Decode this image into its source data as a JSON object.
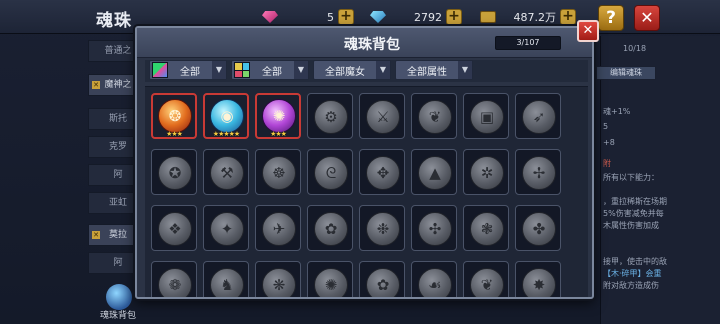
{
  "topbar": {
    "title": "魂珠",
    "resources": [
      {
        "icon": "pink-gem-icon",
        "value": "5"
      },
      {
        "icon": "blue-gem-icon",
        "value": "2792"
      },
      {
        "icon": "treasure-chest-icon",
        "value": "487.2万"
      }
    ],
    "help_label": "?",
    "close_label": "✕"
  },
  "sidebar": {
    "items": [
      "普通之",
      "魔神之",
      "斯托",
      "克罗",
      "阿",
      "亚虹",
      "",
      "莫拉",
      "阿"
    ],
    "bottom_label": "魂珠背包"
  },
  "right_panel": {
    "progress": "10/18",
    "button": "编辑魂珠",
    "lines": [
      "魂+1%",
      "5",
      "+8",
      "附",
      "所有以下能力：",
      "，重拉稀斯在场期",
      "5%伤害减免并每",
      "木属性伤害加成",
      "接甲，使击中的敌",
      "【木·碎甲】会重",
      "附对敌方造成伤"
    ]
  },
  "modal": {
    "title": "魂珠背包",
    "count": "3/107",
    "close_label": "✕",
    "filters": [
      {
        "icon": "rainbow-icon",
        "label": "全部",
        "arrow": "▼"
      },
      {
        "icon": "element-grid-icon",
        "label": "全部",
        "arrow": "▼"
      },
      {
        "label": "全部魔女",
        "arrow": "▼"
      },
      {
        "label": "全部属性",
        "arrow": "▼"
      }
    ],
    "slots": [
      {
        "kind": "fire",
        "glyph": "❂",
        "stars": "★★★"
      },
      {
        "kind": "ice",
        "glyph": "◉",
        "stars": "★★★★★"
      },
      {
        "kind": "arcane",
        "glyph": "✺",
        "stars": "★★★"
      },
      {
        "kind": "locked",
        "glyph": "⚙"
      },
      {
        "kind": "locked",
        "glyph": "⚔"
      },
      {
        "kind": "locked",
        "glyph": "❦"
      },
      {
        "kind": "locked",
        "glyph": "▣"
      },
      {
        "kind": "locked",
        "glyph": "➶"
      },
      {
        "kind": "locked",
        "glyph": "✪"
      },
      {
        "kind": "locked",
        "glyph": "⚒"
      },
      {
        "kind": "locked",
        "glyph": "☸"
      },
      {
        "kind": "locked",
        "glyph": "ᘓ"
      },
      {
        "kind": "locked",
        "glyph": "✥"
      },
      {
        "kind": "locked",
        "glyph": "▲"
      },
      {
        "kind": "locked",
        "glyph": "✲"
      },
      {
        "kind": "locked",
        "glyph": "✢"
      },
      {
        "kind": "locked",
        "glyph": "❖"
      },
      {
        "kind": "locked",
        "glyph": "✦"
      },
      {
        "kind": "locked",
        "glyph": "✈"
      },
      {
        "kind": "locked",
        "glyph": "✿"
      },
      {
        "kind": "locked",
        "glyph": "❉"
      },
      {
        "kind": "locked",
        "glyph": "✣"
      },
      {
        "kind": "locked",
        "glyph": "❃"
      },
      {
        "kind": "locked",
        "glyph": "✤"
      },
      {
        "kind": "locked",
        "glyph": "❁"
      },
      {
        "kind": "locked",
        "glyph": "♞"
      },
      {
        "kind": "locked",
        "glyph": "❋"
      },
      {
        "kind": "locked",
        "glyph": "✺"
      },
      {
        "kind": "locked",
        "glyph": "✿"
      },
      {
        "kind": "locked",
        "glyph": "☙"
      },
      {
        "kind": "locked",
        "glyph": "❦"
      },
      {
        "kind": "locked",
        "glyph": "✸"
      }
    ]
  }
}
